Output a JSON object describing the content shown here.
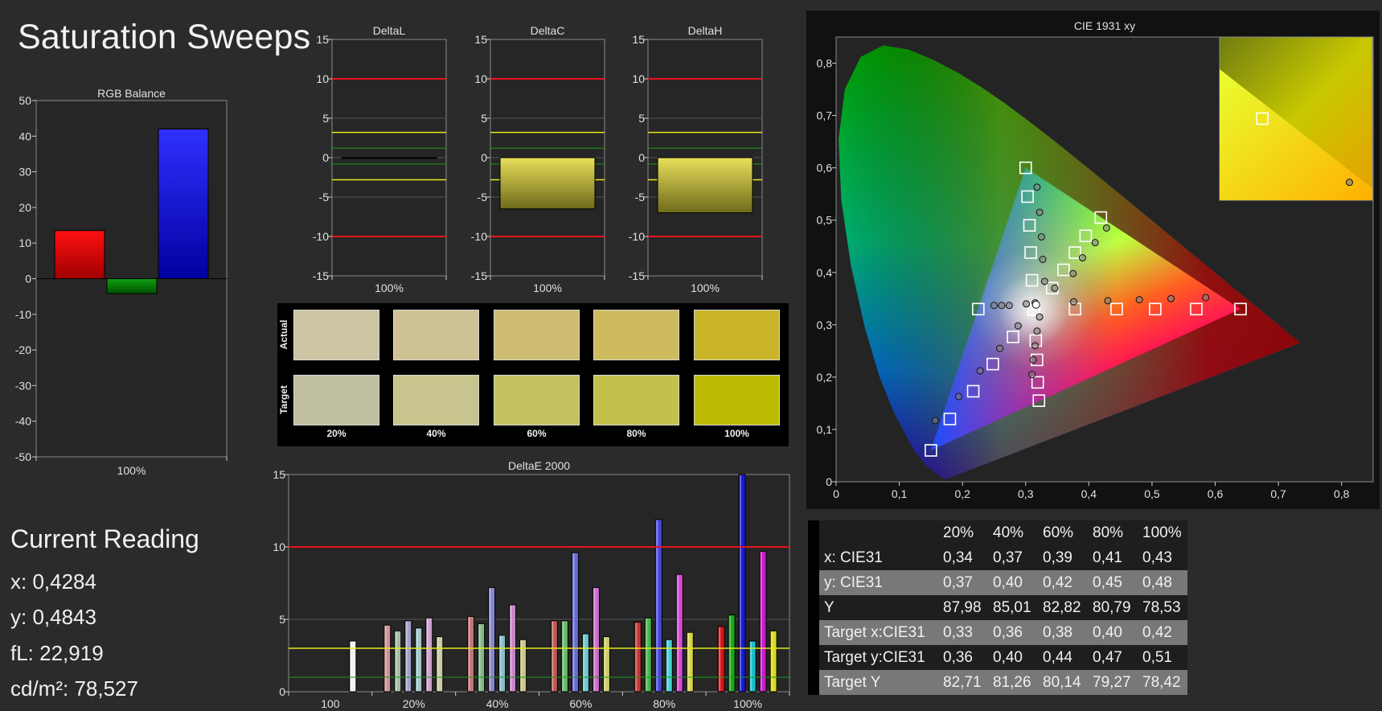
{
  "page_title": "Saturation Sweeps",
  "colors": {
    "background": "#2b2b2b",
    "plot_bg": "#262626",
    "red_limit": "#e8141c",
    "yellow_limit": "#e6e61e",
    "green_limit": "#1a9a1a"
  },
  "chart_data": [
    {
      "id": "rgb_balance",
      "type": "bar",
      "title": "RGB Balance",
      "xlabel": "100%",
      "ylim": [
        -50,
        50
      ],
      "yticks": [
        50,
        40,
        30,
        20,
        10,
        0,
        -10,
        -20,
        -30,
        -40,
        -50
      ],
      "categories": [
        "Red",
        "Green",
        "Blue"
      ],
      "values": [
        13.5,
        -4.2,
        42
      ],
      "bar_colors": [
        "#ff0000",
        "#00a000",
        "#1a1aff"
      ]
    },
    {
      "id": "delta_l",
      "type": "bar",
      "title": "DeltaL",
      "xlabel": "100%",
      "ylim": [
        -15,
        15
      ],
      "yticks": [
        15,
        10,
        5,
        0,
        -5,
        -10,
        -15
      ],
      "values": [
        -0.1
      ],
      "limit_lines": {
        "red": [
          10,
          -10
        ],
        "yellow": [
          3.2,
          -2.8
        ],
        "green": [
          1.2,
          -0.8
        ]
      }
    },
    {
      "id": "delta_c",
      "type": "bar",
      "title": "DeltaC",
      "xlabel": "100%",
      "ylim": [
        -15,
        15
      ],
      "yticks": [
        15,
        10,
        5,
        0,
        -5,
        -10,
        -15
      ],
      "values": [
        -6.5
      ],
      "limit_lines": {
        "red": [
          10,
          -10
        ],
        "yellow": [
          3.2,
          -2.8
        ],
        "green": [
          1.2,
          -0.8
        ]
      }
    },
    {
      "id": "delta_h",
      "type": "bar",
      "title": "DeltaH",
      "xlabel": "100%",
      "ylim": [
        -15,
        15
      ],
      "yticks": [
        15,
        10,
        5,
        0,
        -5,
        -10,
        -15
      ],
      "values": [
        -7
      ],
      "limit_lines": {
        "red": [
          10,
          -10
        ],
        "yellow": [
          3.2,
          -2.8
        ],
        "green": [
          1.2,
          -0.8
        ]
      }
    },
    {
      "id": "delta_e_2000",
      "type": "bar",
      "title": "DeltaE 2000",
      "ylim": [
        0,
        15
      ],
      "yticks": [
        15,
        10,
        5,
        0
      ],
      "group_labels": [
        "100",
        "20%",
        "40%",
        "60%",
        "80%",
        "100%"
      ],
      "groups": [
        {
          "label": "100",
          "values": [
            3.5
          ],
          "colors": [
            "#ffffff"
          ]
        },
        {
          "label": "20%",
          "values": [
            4.6,
            4.2,
            4.9,
            4.4,
            5.1,
            3.8
          ],
          "colors": [
            "#d69a9a",
            "#a9c8a9",
            "#a9a9d6",
            "#a9d0d6",
            "#d6a9d6",
            "#d6d6a9"
          ]
        },
        {
          "label": "40%",
          "values": [
            5.2,
            4.7,
            7.2,
            3.9,
            6.0,
            3.6
          ],
          "colors": [
            "#c97a7a",
            "#8cc08c",
            "#8c8cd6",
            "#8cc8d0",
            "#d08cd0",
            "#d0d08c"
          ]
        },
        {
          "label": "60%",
          "values": [
            4.9,
            4.9,
            9.6,
            4.0,
            7.2,
            3.8
          ],
          "colors": [
            "#c45a5a",
            "#6ec06e",
            "#6e6ee0",
            "#6ed0d8",
            "#d86ed8",
            "#d8d86e"
          ]
        },
        {
          "label": "80%",
          "values": [
            4.8,
            5.1,
            11.9,
            3.6,
            8.1,
            4.1
          ],
          "colors": [
            "#d03a3a",
            "#4ac04a",
            "#4a4ae6",
            "#4ad8e0",
            "#e04ae0",
            "#e0e04a"
          ]
        },
        {
          "label": "100%",
          "values": [
            4.5,
            5.3,
            15.0,
            3.5,
            9.7,
            4.2
          ],
          "colors": [
            "#e01818",
            "#18b018",
            "#1818d8",
            "#18c8d0",
            "#d018d0",
            "#e6e618"
          ]
        }
      ],
      "limit_lines": {
        "red": [
          10
        ],
        "yellow": [
          3
        ],
        "green": [
          1
        ]
      }
    },
    {
      "id": "cie_1931_xy",
      "type": "scatter",
      "title": "CIE 1931 xy",
      "xlim": [
        0,
        0.85
      ],
      "ylim": [
        0,
        0.85
      ],
      "xticks": [
        "0",
        "0,1",
        "0,2",
        "0,3",
        "0,4",
        "0,5",
        "0,6",
        "0,7",
        "0,8"
      ],
      "yticks": [
        "0",
        "0,1",
        "0,2",
        "0,3",
        "0,4",
        "0,5",
        "0,6",
        "0,7",
        "0,8"
      ],
      "gamut": {
        "red": [
          0.64,
          0.33
        ],
        "green": [
          0.3,
          0.6
        ],
        "blue": [
          0.15,
          0.06
        ]
      },
      "white_point": [
        0.3127,
        0.329
      ],
      "targets": [
        [
          0.64,
          0.33
        ],
        [
          0.57,
          0.33
        ],
        [
          0.505,
          0.33
        ],
        [
          0.444,
          0.33
        ],
        [
          0.378,
          0.33
        ],
        [
          0.3,
          0.6
        ],
        [
          0.303,
          0.545
        ],
        [
          0.306,
          0.49
        ],
        [
          0.308,
          0.438
        ],
        [
          0.31,
          0.385
        ],
        [
          0.15,
          0.06
        ],
        [
          0.18,
          0.12
        ],
        [
          0.217,
          0.173
        ],
        [
          0.248,
          0.225
        ],
        [
          0.28,
          0.277
        ],
        [
          0.419,
          0.505
        ],
        [
          0.395,
          0.47
        ],
        [
          0.378,
          0.438
        ],
        [
          0.36,
          0.405
        ],
        [
          0.342,
          0.37
        ],
        [
          0.225,
          0.33
        ],
        [
          0.321,
          0.155
        ],
        [
          0.319,
          0.19
        ],
        [
          0.318,
          0.233
        ],
        [
          0.316,
          0.27
        ],
        [
          0.3127,
          0.329
        ]
      ],
      "actuals": [
        [
          0.585,
          0.352
        ],
        [
          0.53,
          0.35
        ],
        [
          0.48,
          0.348
        ],
        [
          0.43,
          0.346
        ],
        [
          0.376,
          0.344
        ],
        [
          0.318,
          0.563
        ],
        [
          0.322,
          0.515
        ],
        [
          0.325,
          0.468
        ],
        [
          0.327,
          0.425
        ],
        [
          0.33,
          0.383
        ],
        [
          0.157,
          0.117
        ],
        [
          0.194,
          0.163
        ],
        [
          0.228,
          0.212
        ],
        [
          0.259,
          0.255
        ],
        [
          0.288,
          0.298
        ],
        [
          0.428,
          0.485
        ],
        [
          0.41,
          0.457
        ],
        [
          0.39,
          0.428
        ],
        [
          0.375,
          0.398
        ],
        [
          0.346,
          0.37
        ],
        [
          0.25,
          0.337
        ],
        [
          0.262,
          0.337
        ],
        [
          0.274,
          0.337
        ],
        [
          0.301,
          0.34
        ],
        [
          0.315,
          0.342
        ],
        [
          0.31,
          0.205
        ],
        [
          0.312,
          0.233
        ],
        [
          0.315,
          0.26
        ],
        [
          0.318,
          0.288
        ],
        [
          0.322,
          0.315
        ]
      ]
    }
  ],
  "cie_inset": {
    "target_dot": [
      0.28,
      0.5
    ],
    "actual_dot": [
      0.85,
      0.89
    ]
  },
  "swatches": {
    "row_labels": [
      "Actual",
      "Target"
    ],
    "col_labels": [
      "20%",
      "40%",
      "60%",
      "80%",
      "100%"
    ],
    "actual": [
      "#cdc4a4",
      "#cec194",
      "#cdbc71",
      "#cdbb5e",
      "#c9b42a"
    ],
    "target": [
      "#c0bf9f",
      "#c7c48d",
      "#c5c25f",
      "#c3c04c",
      "#bdbb01"
    ]
  },
  "current_reading": {
    "title": "Current Reading",
    "x": "x: 0,4284",
    "y": "y: 0,4843",
    "fl": "fL: 22,919",
    "cdm2": "cd/m²: 78,527"
  },
  "table": {
    "headers": [
      "20%",
      "40%",
      "60%",
      "80%",
      "100%"
    ],
    "rows": [
      {
        "label": "x: CIE31",
        "values": [
          "0,34",
          "0,37",
          "0,39",
          "0,41",
          "0,43"
        ]
      },
      {
        "label": "y: CIE31",
        "values": [
          "0,37",
          "0,40",
          "0,42",
          "0,45",
          "0,48"
        ]
      },
      {
        "label": "Y",
        "values": [
          "87,98",
          "85,01",
          "82,82",
          "80,79",
          "78,53"
        ]
      },
      {
        "label": "Target x:CIE31",
        "values": [
          "0,33",
          "0,36",
          "0,38",
          "0,40",
          "0,42"
        ]
      },
      {
        "label": "Target y:CIE31",
        "values": [
          "0,36",
          "0,40",
          "0,44",
          "0,47",
          "0,51"
        ]
      },
      {
        "label": "Target Y",
        "values": [
          "82,71",
          "81,26",
          "80,14",
          "79,27",
          "78,42"
        ]
      }
    ]
  }
}
